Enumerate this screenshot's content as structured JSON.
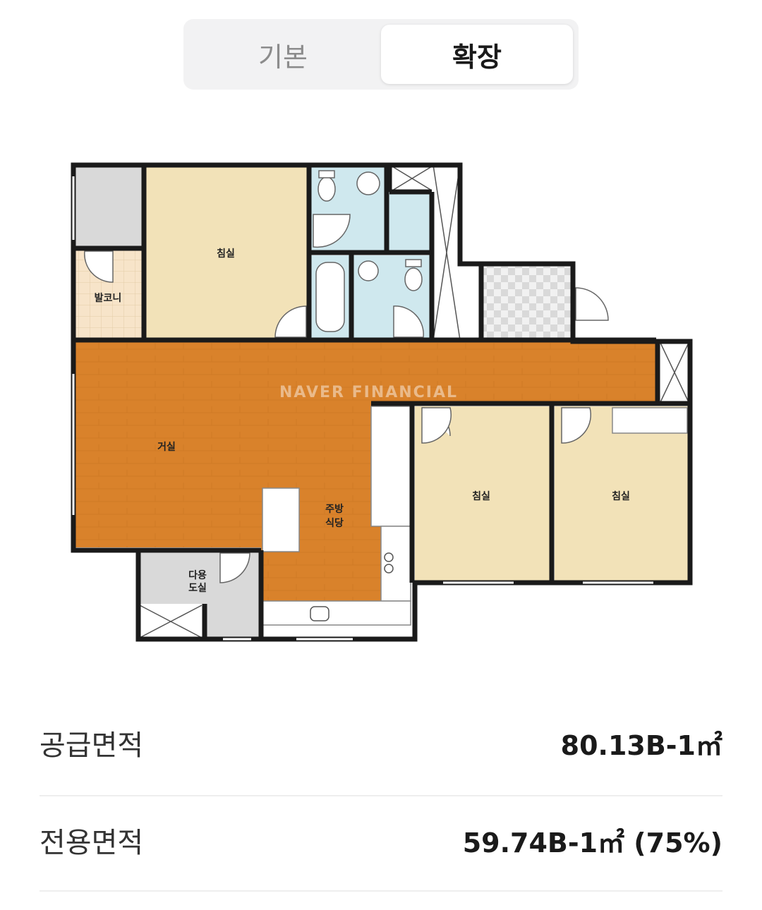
{
  "toggle": {
    "basic_label": "기본",
    "extended_label": "확장",
    "selected": "확장"
  },
  "floorplan": {
    "watermark": "NAVER FINANCIAL",
    "rooms": {
      "bedroom_top": "침실",
      "balcony": "발코니",
      "living": "거실",
      "kitchen_line1": "주방",
      "kitchen_line2": "식당",
      "bedroom_mid": "침실",
      "bedroom_right": "침실",
      "utility_line1": "다용",
      "utility_line2": "도실"
    },
    "colors": {
      "wall": "#1a1a1a",
      "wood": "#d9822b",
      "bedroom": "#f2e2b8",
      "bathroom": "#cfe8ee",
      "gray": "#d9d9d9",
      "tile": "#f7e4c9"
    }
  },
  "area": {
    "supply_label": "공급면적",
    "supply_value": "80.13B-1㎡",
    "exclusive_label": "전용면적",
    "exclusive_value": "59.74B-1㎡ (75%)"
  }
}
